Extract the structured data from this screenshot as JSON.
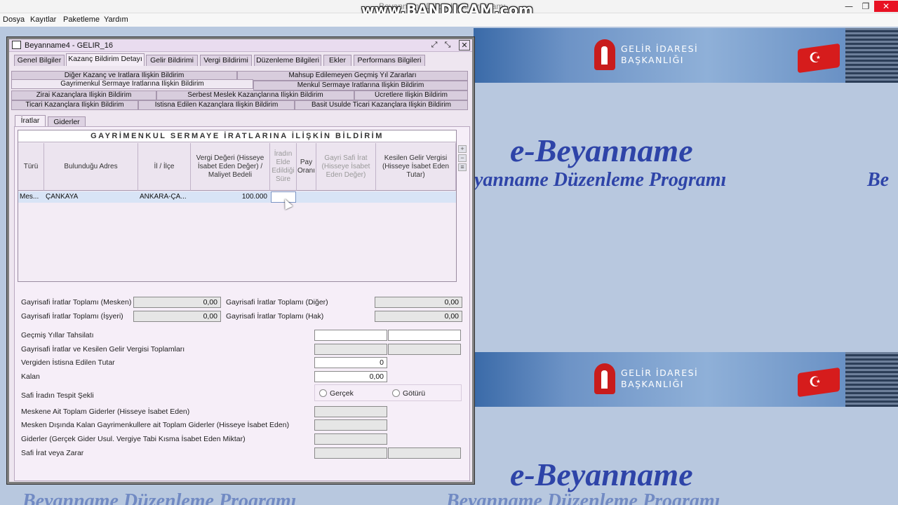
{
  "app": {
    "title_fragment": "Beyanname Düzenleme Programı",
    "watermark": "www.BANDICAM.com",
    "minimize": "—",
    "restore": "❐",
    "close": "✕"
  },
  "menu": [
    "Dosya",
    "Kayıtlar",
    "Paketleme",
    "Yardım"
  ],
  "background": {
    "gib_line1": "GELİR İDARESİ",
    "gib_line2": "BAŞKANLIĞI",
    "ebeyanname": "e-Beyanname",
    "program": "Beyanname Düzenleme Programı",
    "program_clip_right": "Be",
    "program_clip_left": "yanname Düzenleme Programı"
  },
  "frame": {
    "title": "Beyanname4 - GELIR_16",
    "ctrl_detach": "⤢",
    "ctrl_max": "⤡",
    "ctrl_close": "✕"
  },
  "tabs": [
    "Genel Bilgiler",
    "Kazanç Bildirim Detayı",
    "Gelir Bildirimi",
    "Vergi Bildirimi",
    "Düzenleme Bilgileri",
    "Ekler",
    "Performans Bilgileri"
  ],
  "subtabs": {
    "row1": [
      "Diğer Kazanç ve İratlara İlişkin Bildirim",
      "Mahsup Edilemeyen Geçmiş Yıl Zararları"
    ],
    "row2": [
      "Gayrimenkul Sermaye İratlarına İlişkin Bildirim",
      "Menkul Sermaye İratlarına İlişkin Bildirim"
    ],
    "row3": [
      "Zirai Kazançlara İlişkin Bildirim",
      "Serbest Meslek Kazançlarına İlişkin Bildirim",
      "Ücretlere İlişkin Bildirim"
    ],
    "row4": [
      "Ticari Kazançlara İlişkin Bildirim",
      "İstisna Edilen Kazançlara İlişkin Bildirim",
      "Basit Usulde Ticari Kazançlara İlişkin Bildirim"
    ]
  },
  "inner_tabs": [
    "İratlar",
    "Giderler"
  ],
  "table": {
    "title": "GAYRİMENKUL SERMAYE İRATLARINA İLİŞKİN BİLDİRİM",
    "headers": [
      "Türü",
      "Bulunduğu Adres",
      "İl / İlçe",
      "Vergi Değeri (Hisseye İsabet Eden Değer) / Maliyet Bedeli",
      "İradın Elde Edildiği Süre",
      "Pay Oranı",
      "Gayri Safi İrat (Hisseye İsabet Eden Değer)",
      "Kesilen Gelir Vergisi (Hisseye İsabet Eden Tutar)"
    ],
    "rows": [
      [
        "Mes...",
        "ÇANKAYA",
        "ANKARA-ÇA...",
        "100.000",
        "",
        "",
        "",
        ""
      ]
    ],
    "side_buttons": [
      "+",
      "−",
      "≡"
    ]
  },
  "totals": {
    "mesken_label": "Gayrisafi İratlar Toplamı (Mesken)",
    "mesken_value": "0,00",
    "isyeri_label": "Gayrisafi İratlar Toplamı (İşyeri)",
    "isyeri_value": "0,00",
    "diger_label": "Gayrisafi İratlar Toplamı (Diğer)",
    "diger_value": "0,00",
    "hak_label": "Gayrisafi İratlar Toplamı (Hak)",
    "hak_value": "0,00"
  },
  "form": {
    "gecmis_label": "Geçmiş Yıllar Tahsilatı",
    "toplamlar_label": "Gayrisafi İratlar ve Kesilen Gelir Vergisi Toplamları",
    "istisna_label": "Vergiden İstisna Edilen Tutar",
    "istisna_value": "0",
    "kalan_label": "Kalan",
    "kalan_value": "0,00",
    "tespit_label": "Safi İradın Tespit Şekli",
    "radio_gercek": "Gerçek",
    "radio_goturu": "Götürü",
    "mesken_gider_label": "Meskene Ait Toplam Giderler (Hisseye İsabet Eden)",
    "diger_gider_label": "Mesken Dışında Kalan Gayrimenkullere ait Toplam Giderler (Hisseye İsabet Eden)",
    "gercek_gider_label": "Giderler (Gerçek Gider Usul. Vergiye Tabi Kısma İsabet Eden Miktar)",
    "safi_label": "Safi İrat veya Zarar"
  }
}
